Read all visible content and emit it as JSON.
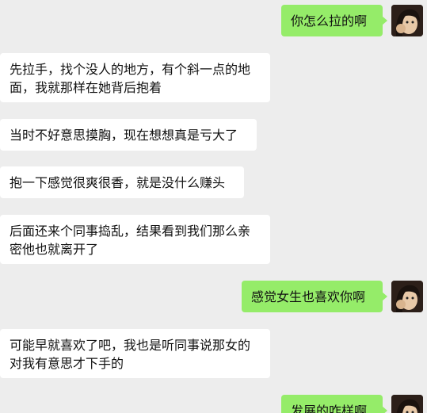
{
  "messages": [
    {
      "side": "right",
      "text": "你怎么拉的啊"
    },
    {
      "side": "left",
      "text": "先拉手，找个没人的地方，有个斜一点的地面，我就那样在她背后抱着"
    },
    {
      "side": "left",
      "text": "当时不好意思摸胸，现在想想真是亏大了"
    },
    {
      "side": "left",
      "text": "抱一下感觉很爽很香，就是没什么赚头"
    },
    {
      "side": "left",
      "text": "后面还来个同事捣乱，结果看到我们那么亲密他也就离开了"
    },
    {
      "side": "right",
      "text": "感觉女生也喜欢你啊"
    },
    {
      "side": "left",
      "text": "可能早就喜欢了吧，我也是听同事说那女的对我有意思才下手的"
    },
    {
      "side": "right",
      "text": "发展的咋样啊"
    }
  ],
  "colors": {
    "background": "#ededed",
    "outgoing_bubble": "#95ec69",
    "incoming_bubble": "#ffffff"
  },
  "icons": {
    "self_avatar": "user-avatar-icon"
  }
}
